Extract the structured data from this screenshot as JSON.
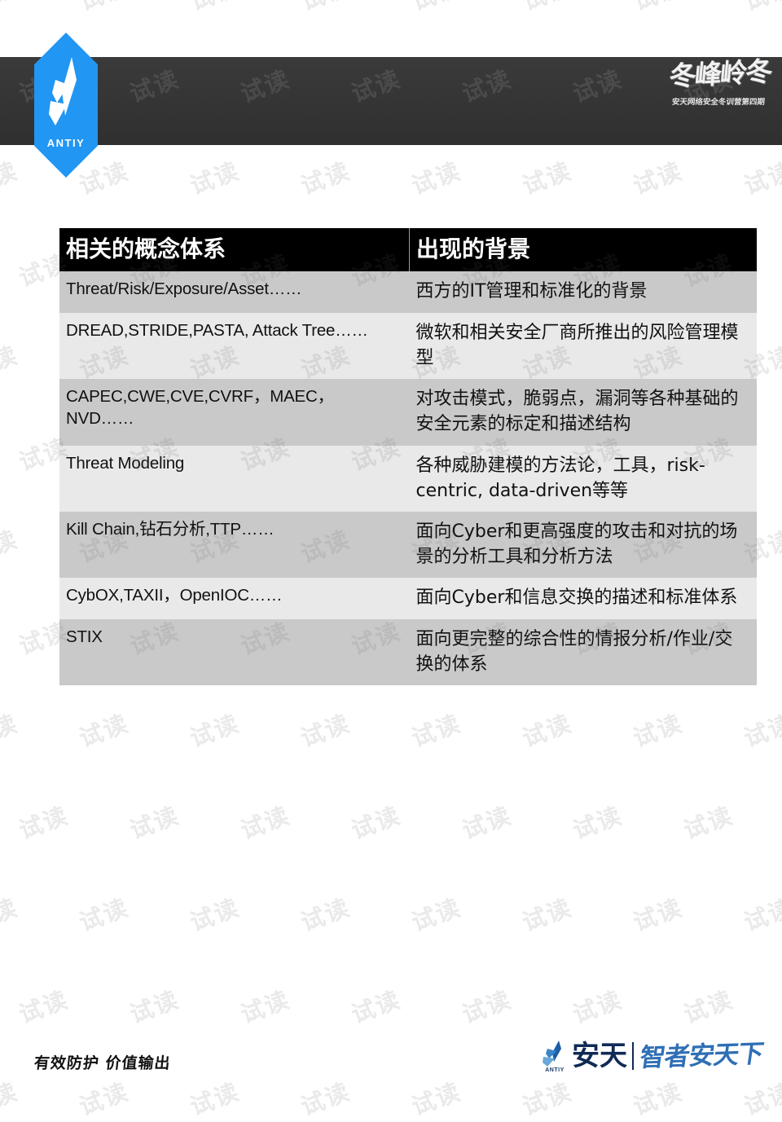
{
  "header": {
    "brand_logo_word": "ANTIY",
    "brand_logo_icon": "antiy-feather-icon",
    "calligraphy_main": "冬峰岭冬",
    "calligraphy_sub": "安天网络安全冬训营第四期"
  },
  "watermark": {
    "text": "试读"
  },
  "table": {
    "columns": [
      "相关的概念体系",
      "出现的背景"
    ],
    "rows": [
      {
        "concept": "Threat/Risk/Exposure/Asset……",
        "background": "西方的IT管理和标准化的背景"
      },
      {
        "concept": "DREAD,STRIDE,PASTA, Attack Tree……",
        "background": "微软和相关安全厂商所推出的风险管理模型"
      },
      {
        "concept": "CAPEC,CWE,CVE,CVRF，MAEC，NVD……",
        "background": "对攻击模式，脆弱点，漏洞等各种基础的安全元素的标定和描述结构"
      },
      {
        "concept": "Threat Modeling",
        "background": "各种威胁建模的方法论，工具，risk-centric, data-driven等等"
      },
      {
        "concept": "Kill Chain,钻石分析,TTP……",
        "background": "面向Cyber和更高强度的攻击和对抗的场景的分析工具和分析方法"
      },
      {
        "concept": "CybOX,TAXII，OpenIOC……",
        "background": "面向Cyber和信息交换的描述和标准体系"
      },
      {
        "concept": "STIX",
        "background": "面向更完整的综合性的情报分析/作业/交换的体系"
      }
    ]
  },
  "footer": {
    "slogan": "有效防护 价值输出",
    "brand_mark_word": "ANTIY",
    "brand_name": "安天",
    "brand_tagline": "智者安天下"
  },
  "colors": {
    "accent_blue": "#2196f3",
    "header_bar": "#363636",
    "table_header_bg": "#000000",
    "row_dark": "#c9c9c9",
    "row_light": "#e9e9e9",
    "footer_navy": "#102a54",
    "footer_blue": "#2f6fb5"
  }
}
